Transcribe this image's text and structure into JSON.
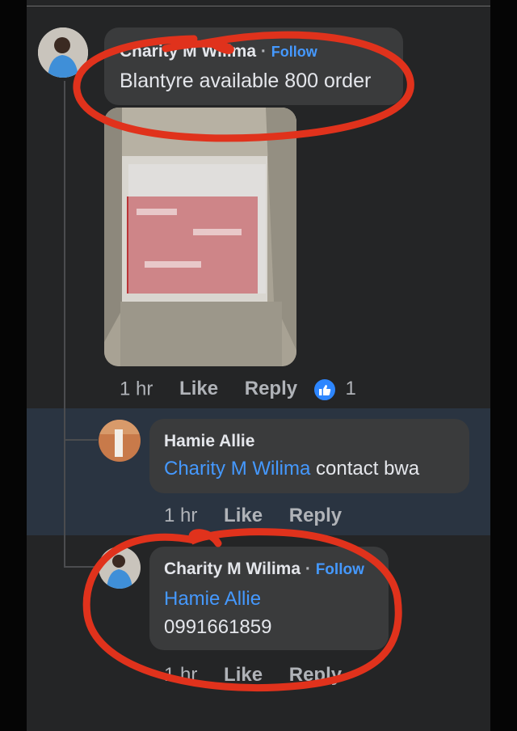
{
  "comment1": {
    "author": "Charity M Wilima",
    "separator": "·",
    "follow_label": "Follow",
    "text": "Blantyre available 800 order",
    "time": "1 hr",
    "like_label": "Like",
    "reply_label": "Reply",
    "reaction_count": "1"
  },
  "comment2": {
    "author": "Hamie Allie",
    "mention": "Charity M Wilima",
    "text": "contact bwa",
    "time": "1 hr",
    "like_label": "Like",
    "reply_label": "Reply"
  },
  "comment3": {
    "author": "Charity M Wilima",
    "separator": "·",
    "follow_label": "Follow",
    "mention": "Hamie Allie",
    "text": "0991661859",
    "time": "1 hr",
    "like_label": "Like",
    "reply_label": "Reply"
  },
  "colors": {
    "background": "#242526",
    "bubble": "#3a3b3c",
    "link": "#4599ff",
    "highlight_row": "#2a3441",
    "annotation": "#e0321c",
    "like_badge": "#2d86ff"
  }
}
